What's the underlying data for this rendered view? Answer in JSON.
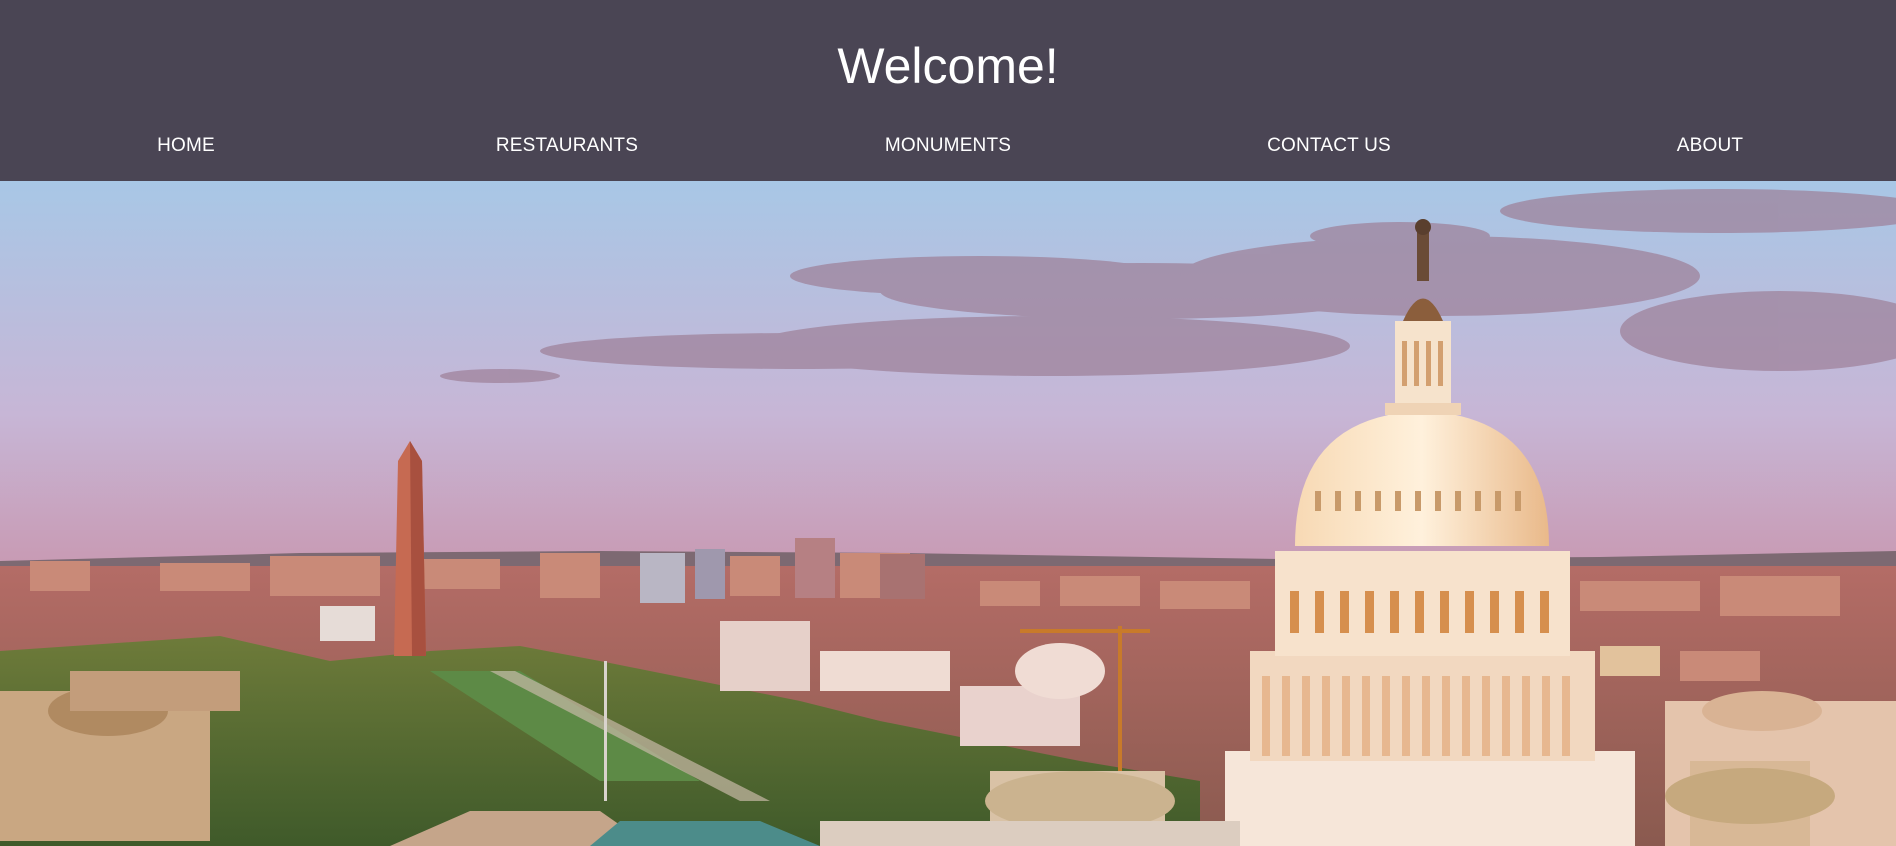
{
  "header": {
    "title": "Welcome!",
    "background": "#4a4554",
    "text_color": "#ffffff"
  },
  "nav": {
    "items": [
      {
        "label": "HOME"
      },
      {
        "label": "RESTAURANTS"
      },
      {
        "label": "MONUMENTS"
      },
      {
        "label": "CONTACT US"
      },
      {
        "label": "ABOUT"
      }
    ]
  },
  "hero": {
    "image_subject": "Washington D.C. skyline at sunset with the Capitol dome and the Washington Monument"
  }
}
